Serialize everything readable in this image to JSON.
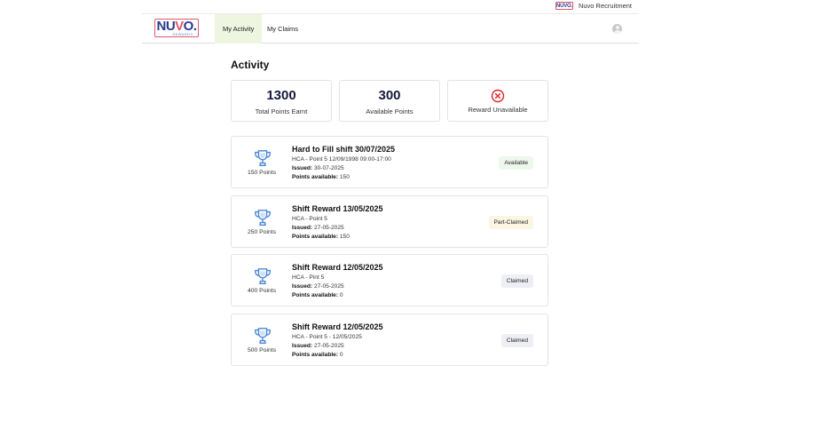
{
  "topbar": {
    "org_logo": "NUVO.",
    "org_name": "Nuvo Recruitment"
  },
  "brand": {
    "logo_text_1": "NU",
    "logo_text_2": "V",
    "logo_text_3": "O.",
    "logo_sub": "REWARDS"
  },
  "nav": {
    "tabs": [
      {
        "label": "My Activity",
        "active": true
      },
      {
        "label": "My Claims",
        "active": false
      }
    ]
  },
  "page": {
    "title": "Activity"
  },
  "stats": [
    {
      "value": "1300",
      "label": "Total Points Earnt"
    },
    {
      "value": "300",
      "label": "Available Points"
    },
    {
      "icon": "x-circle-icon",
      "label": "Reward Unavailable"
    }
  ],
  "issued_label": "Issued:",
  "available_label": "Points available:",
  "activities": [
    {
      "title": "Hard to Fill shift 30/07/2025",
      "detail": "HCA - Point 5 12/09/1998 09:00-17:00",
      "issued": "30-07-2025",
      "points_available": "150",
      "points": "150 Points",
      "status": "Available"
    },
    {
      "title": "Shift Reward 13/05/2025",
      "detail": "HCA - Point 5",
      "issued": "27-05-2025",
      "points_available": "150",
      "points": "250 Points",
      "status": "Part-Claimed"
    },
    {
      "title": "Shift Reward 12/05/2025",
      "detail": "HCA - Pint 5",
      "issued": "27-05-2025",
      "points_available": "0",
      "points": "400 Points",
      "status": "Claimed"
    },
    {
      "title": "Shift Reward 12/05/2025",
      "detail": "HCA - Point 5 - 12/05/2025",
      "issued": "27-05-2025",
      "points_available": "0",
      "points": "500 Points",
      "status": "Claimed"
    }
  ],
  "colors": {
    "accent_red": "#e0566a",
    "brand_navy": "#2b3a8c",
    "trophy_blue": "#4a86d8",
    "active_tab_bg": "#eef5e0",
    "x_icon_red": "#e02424"
  }
}
